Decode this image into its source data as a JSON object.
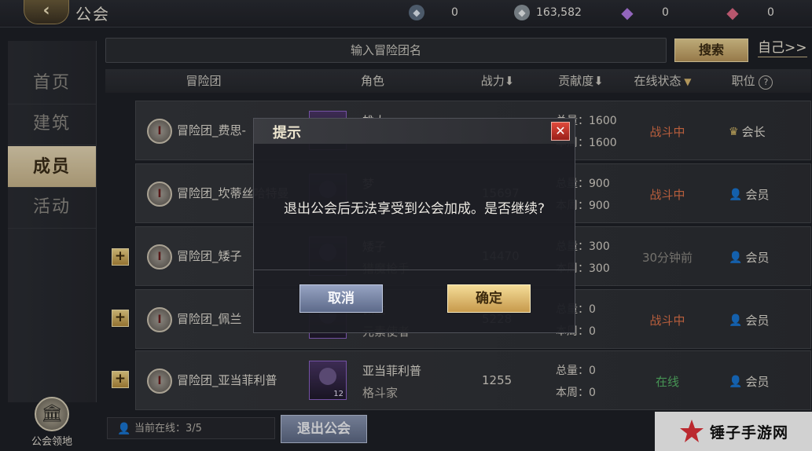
{
  "topbar": {
    "back_icon": "back-arrow-icon",
    "title": "公会",
    "currencies": [
      {
        "icon": "stamina-icon",
        "value": "0",
        "color": "#9fb3c9"
      },
      {
        "icon": "silver-icon",
        "value": "163,582",
        "color": "#c9d1d6"
      },
      {
        "icon": "diamond-icon",
        "value": "0",
        "color": "#a86bd6"
      },
      {
        "icon": "ruby-icon",
        "value": "0",
        "color": "#d65a78"
      }
    ]
  },
  "sidenav": {
    "items": [
      {
        "label": "首页"
      },
      {
        "label": "建筑"
      },
      {
        "label": "成员",
        "active": true
      },
      {
        "label": "活动"
      }
    ],
    "guild_land_label": "公会领地"
  },
  "search": {
    "placeholder": "输入冒险团名",
    "button_label": "搜索",
    "self_link": "自己>>"
  },
  "table": {
    "headers": {
      "guild": "冒险团",
      "character": "角色",
      "power": "战力⬇",
      "contribution": "贡献度⬇",
      "status": "在线状态",
      "position": "职位"
    },
    "rows": [
      {
        "guild": "冒险团_费思-",
        "char_name": "雄大",
        "char_class": "",
        "power": "",
        "total": "总量：1600",
        "week": "本周：1600",
        "status": "战斗中",
        "status_type": "fight",
        "role": "会长",
        "role_icon": "crown-icon",
        "plus": false
      },
      {
        "guild": "冒险团_坎蒂丝哈特曼",
        "char_name": "梦",
        "char_class": "",
        "power": "15697",
        "total": "总量：900",
        "week": "本周：900",
        "status": "战斗中",
        "status_type": "fight",
        "role": "会员",
        "role_icon": "person-icon",
        "plus": false
      },
      {
        "guild": "冒险团_矮子",
        "char_name": "矮子",
        "char_class": "猎魔枪手",
        "power": "14470",
        "total": "总量：300",
        "week": "本周：300",
        "status": "30分钟前",
        "status_type": "offline",
        "role": "会员",
        "role_icon": "person-icon",
        "plus": true
      },
      {
        "guild": "冒险团_佩兰",
        "char_name": "佩兰",
        "char_class": "元素使者",
        "power": "5228",
        "total": "总量：0",
        "week": "本周：0",
        "status": "战斗中",
        "status_type": "fight",
        "role": "会员",
        "role_icon": "person-icon",
        "plus": true
      },
      {
        "guild": "冒险团_亚当菲利普",
        "char_name": "亚当菲利普",
        "char_class": "格斗家",
        "power": "1255",
        "total": "总量：0",
        "week": "本周：0",
        "status": "在线",
        "status_type": "online",
        "role": "会员",
        "role_icon": "person-icon",
        "plus": true,
        "avatar_level": "12"
      }
    ]
  },
  "footer": {
    "online_count": "当前在线：3/5",
    "quit_button": "退出公会",
    "watermark": "锤子手游网"
  },
  "dialog": {
    "title": "提示",
    "message": "退出公会后无法享受到公会加成。是否继续?",
    "cancel_label": "取消",
    "ok_label": "确定",
    "close_icon": "close-icon"
  }
}
